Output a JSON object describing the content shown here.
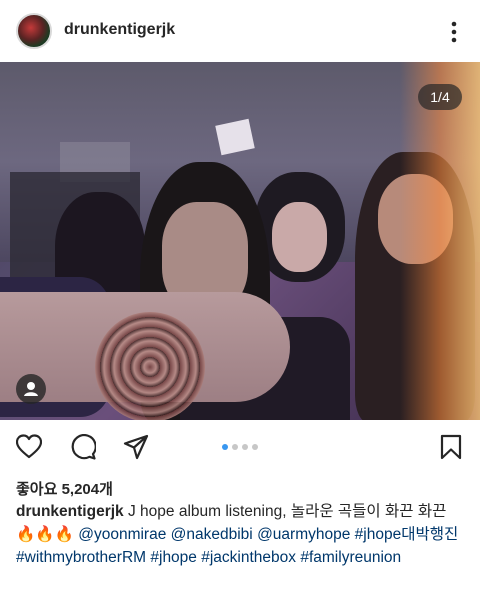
{
  "post": {
    "username": "drunkentigerjk",
    "photo_counter": "1/4",
    "likes": "좋아요 5,204개",
    "caption": {
      "username": "drunkentigerjk",
      "text": " J hope album listening, 놀라운 곡들이 화끈 화끈 ",
      "emoji": "🔥🔥🔥",
      "mentions": [
        "@yoonmirae",
        "@nakedbibi",
        "@uarmyhope"
      ],
      "hashtags": [
        "#jhope대박행진",
        "#withmybrotherRM",
        "#jhope",
        "#jackinthebox",
        "#familyreunion"
      ]
    },
    "carousel": {
      "current": 1,
      "total": 4
    }
  },
  "icons": {
    "more": "more-vertical-icon",
    "like": "heart-icon",
    "comment": "comment-icon",
    "share": "share-icon",
    "save": "bookmark-icon",
    "tag": "user-tag-icon"
  },
  "colors": {
    "text": "#262626",
    "link": "#00376b",
    "dot_active": "#3897f0",
    "dot_inactive": "#c7c7c7"
  }
}
